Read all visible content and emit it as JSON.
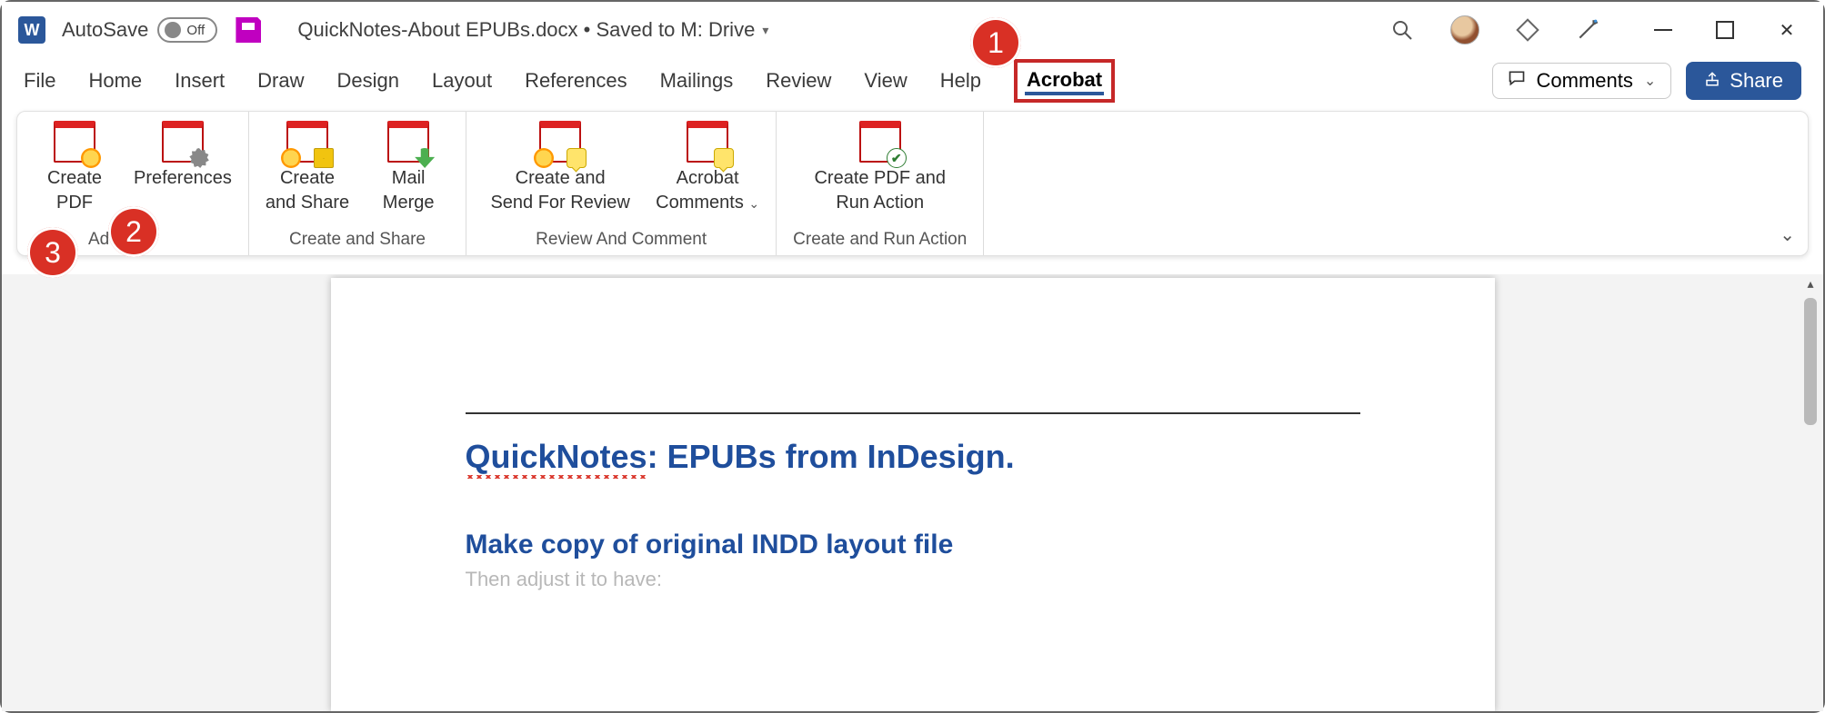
{
  "titlebar": {
    "autosave_label": "AutoSave",
    "autosave_state": "Off",
    "document_title": "QuickNotes-About EPUBs.docx • Saved to M: Drive"
  },
  "tabs": {
    "items": [
      "File",
      "Home",
      "Insert",
      "Draw",
      "Design",
      "Layout",
      "References",
      "Mailings",
      "Review",
      "View",
      "Help",
      "Acrobat"
    ],
    "active": "Acrobat",
    "comments_label": "Comments",
    "share_label": "Share"
  },
  "ribbon": {
    "groups": [
      {
        "label": "Adobe Acrobat",
        "label_visible": "Ad",
        "items": [
          {
            "line1": "Create",
            "line2": "PDF"
          },
          {
            "line1": "Preferences",
            "line2": ""
          }
        ]
      },
      {
        "label": "Create and Share",
        "items": [
          {
            "line1": "Create",
            "line2": "and Share"
          },
          {
            "line1": "Mail",
            "line2": "Merge"
          }
        ]
      },
      {
        "label": "Review And Comment",
        "items": [
          {
            "line1": "Create and",
            "line2": "Send For Review"
          },
          {
            "line1": "Acrobat",
            "line2": "Comments"
          }
        ]
      },
      {
        "label": "Create and Run Action",
        "items": [
          {
            "line1": "Create PDF and",
            "line2": "Run Action"
          }
        ]
      }
    ]
  },
  "annotations": {
    "a1": "1",
    "a2": "2",
    "a3": "3"
  },
  "document": {
    "title_prefix": "QuickNotes",
    "title_rest": ": EPUBs from InDesign.",
    "h2_1": "Make copy of original INDD layout file",
    "p1_partial": "Then adjust it to have:"
  }
}
